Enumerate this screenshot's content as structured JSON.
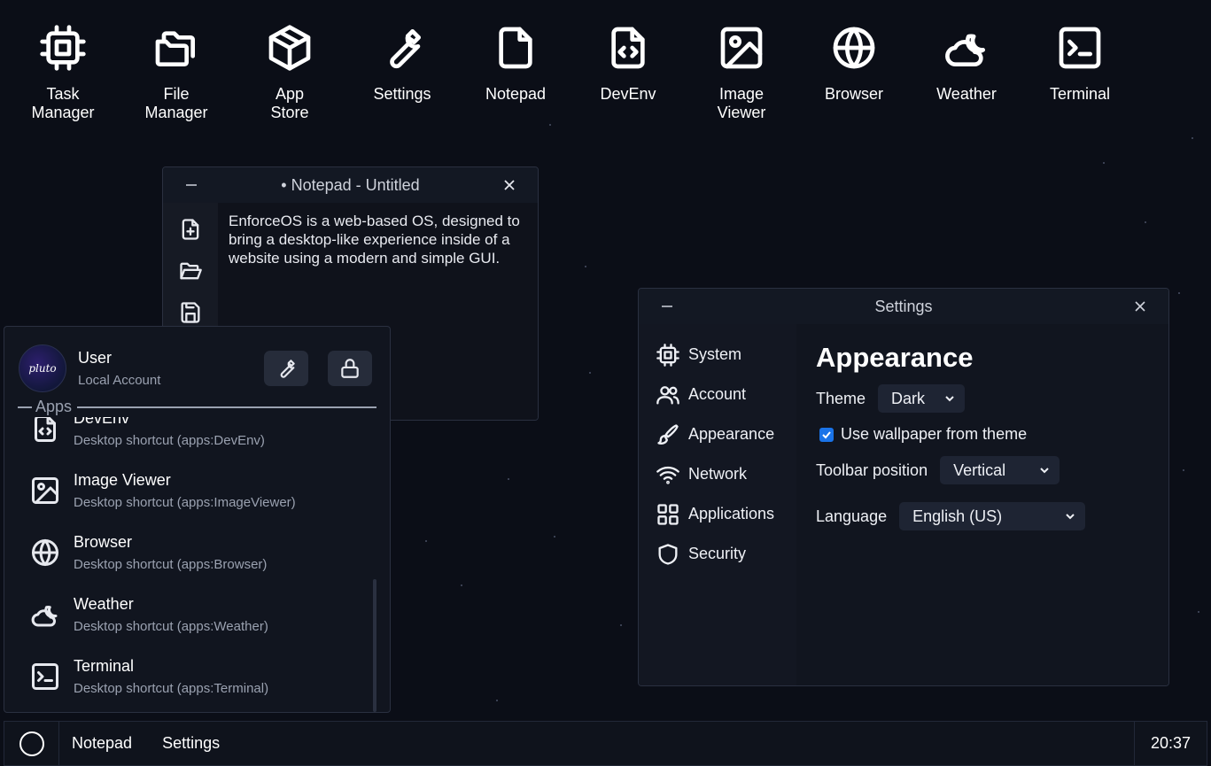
{
  "desktop": {
    "icons": [
      {
        "label": "Task\nManager",
        "icon": "chip-icon"
      },
      {
        "label": "File\nManager",
        "icon": "folder-icon"
      },
      {
        "label": "App\nStore",
        "icon": "box-icon"
      },
      {
        "label": "Settings",
        "icon": "wrench-icon"
      },
      {
        "label": "Notepad",
        "icon": "file-icon"
      },
      {
        "label": "DevEnv",
        "icon": "code-file-icon"
      },
      {
        "label": "Image\nViewer",
        "icon": "image-icon"
      },
      {
        "label": "Browser",
        "icon": "globe-icon"
      },
      {
        "label": "Weather",
        "icon": "cloud-moon-icon"
      },
      {
        "label": "Terminal",
        "icon": "terminal-icon"
      }
    ]
  },
  "notepad": {
    "title": "• Notepad - Untitled",
    "text": "EnforceOS is a web-based OS, designed to bring a desktop-like experience inside of a website using a modern and simple GUI."
  },
  "settings": {
    "title": "Settings",
    "nav": [
      {
        "label": "System",
        "icon": "chip-icon"
      },
      {
        "label": "Account",
        "icon": "users-icon"
      },
      {
        "label": "Appearance",
        "icon": "brush-icon"
      },
      {
        "label": "Network",
        "icon": "wifi-icon"
      },
      {
        "label": "Applications",
        "icon": "grid-icon"
      },
      {
        "label": "Security",
        "icon": "shield-icon"
      }
    ],
    "heading": "Appearance",
    "theme_label": "Theme",
    "theme_value": "Dark",
    "wallpaper_label": "Use wallpaper from theme",
    "wallpaper_checked": true,
    "toolbar_label": "Toolbar position",
    "toolbar_value": "Vertical",
    "language_label": "Language",
    "language_value": "English (US)"
  },
  "start_menu": {
    "avatar_text": "pluto",
    "user_name": "User",
    "user_sub": "Local Account",
    "apps_header": "Apps",
    "items": [
      {
        "title": "DevEnv",
        "desc": "Desktop shortcut (apps:DevEnv)",
        "icon": "code-file-icon"
      },
      {
        "title": "Image Viewer",
        "desc": "Desktop shortcut (apps:ImageViewer)",
        "icon": "image-icon"
      },
      {
        "title": "Browser",
        "desc": "Desktop shortcut (apps:Browser)",
        "icon": "globe-icon"
      },
      {
        "title": "Weather",
        "desc": "Desktop shortcut (apps:Weather)",
        "icon": "cloud-moon-icon"
      },
      {
        "title": "Terminal",
        "desc": "Desktop shortcut (apps:Terminal)",
        "icon": "terminal-icon"
      }
    ]
  },
  "taskbar": {
    "apps": [
      "Notepad",
      "Settings"
    ],
    "clock": "20:37"
  },
  "colors": {
    "background": "#0b0e17",
    "window": "#11151f",
    "accent": "#1a73e8"
  }
}
